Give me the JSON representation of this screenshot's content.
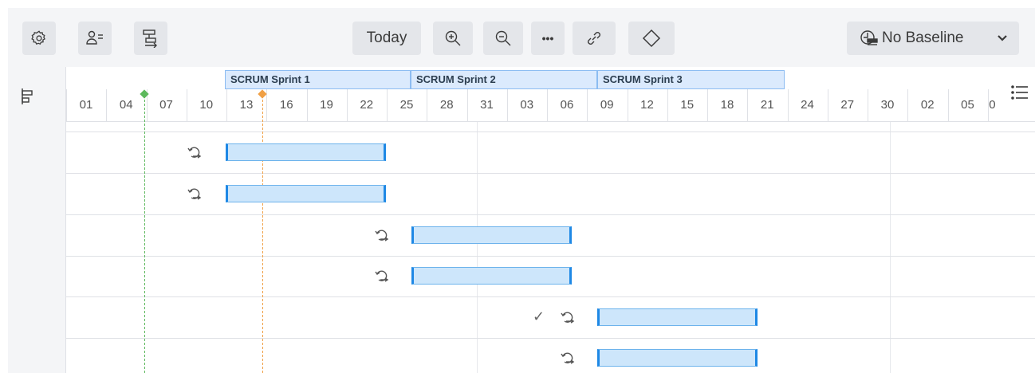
{
  "toolbar": {
    "icons": [
      "gear-icon",
      "user-list-icon",
      "hierarchy-arrow-icon",
      "zoom-in-icon",
      "zoom-out-icon",
      "more-icon",
      "link-icon",
      "diamond-icon",
      "baseline-icon",
      "chevron-down-icon"
    ],
    "today_label": "Today",
    "more_label": "•••",
    "baseline_label": "No Baseline"
  },
  "timeline": {
    "sprints": [
      "SCRUM Sprint 1",
      "SCRUM Sprint 2",
      "SCRUM Sprint 3"
    ],
    "days": [
      "01",
      "04",
      "07",
      "10",
      "13",
      "16",
      "19",
      "22",
      "25",
      "28",
      "31",
      "03",
      "06",
      "09",
      "12",
      "15",
      "18",
      "21",
      "24",
      "27",
      "30",
      "02",
      "05",
      "0"
    ],
    "today_marker_color": "#5cb85c",
    "current_marker_color": "#f0a045"
  },
  "rows": [
    {
      "recurring": true,
      "done": false
    },
    {
      "recurring": true,
      "done": false
    },
    {
      "recurring": true,
      "done": false
    },
    {
      "recurring": true,
      "done": false
    },
    {
      "recurring": true,
      "done": true,
      "done_label": "✓"
    },
    {
      "recurring": true,
      "done": false
    }
  ],
  "colors": {
    "bar_fill": "#cde6fb",
    "bar_edge": "#1e88e5",
    "sprint_fill": "#dbeafd"
  }
}
